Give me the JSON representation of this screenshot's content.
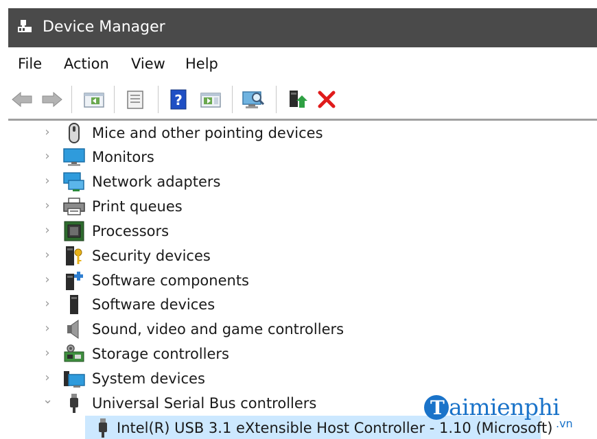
{
  "window": {
    "title": "Device Manager"
  },
  "menu": [
    "File",
    "Action",
    "View",
    "Help"
  ],
  "toolbar": {
    "buttons": [
      "back-icon",
      "forward-icon",
      "properties-pane-icon",
      "properties-sheet-icon",
      "help-icon",
      "action-pane-icon",
      "scan-hardware-icon",
      "update-driver-icon",
      "uninstall-icon"
    ],
    "uninstall_color": "#e01b1b"
  },
  "tree": {
    "nodes": [
      {
        "label": "Mice and other pointing devices",
        "icon": "mouse-icon",
        "expander": "›"
      },
      {
        "label": "Monitors",
        "icon": "monitor-icon",
        "expander": "›"
      },
      {
        "label": "Network adapters",
        "icon": "network-adapter-icon",
        "expander": "›"
      },
      {
        "label": "Print queues",
        "icon": "printer-icon",
        "expander": "›"
      },
      {
        "label": "Processors",
        "icon": "processor-icon",
        "expander": "›"
      },
      {
        "label": "Security devices",
        "icon": "security-device-icon",
        "expander": "›"
      },
      {
        "label": "Software components",
        "icon": "software-component-icon",
        "expander": "›"
      },
      {
        "label": "Software devices",
        "icon": "software-device-icon",
        "expander": "›"
      },
      {
        "label": "Sound, video and game controllers",
        "icon": "speaker-icon",
        "expander": "›"
      },
      {
        "label": "Storage controllers",
        "icon": "storage-controller-icon",
        "expander": "›"
      },
      {
        "label": "System devices",
        "icon": "system-device-icon",
        "expander": "›"
      },
      {
        "label": "Universal Serial Bus controllers",
        "icon": "usb-icon",
        "expander": "⌄"
      }
    ],
    "children": [
      {
        "label": "Intel(R) USB 3.1 eXtensible Host Controller - 1.10 (Microsoft)",
        "icon": "usb-device-icon",
        "selected": true
      }
    ],
    "selection_color": "#cce8ff"
  },
  "watermark": {
    "letter": "T",
    "text": "aimienphi",
    "tld": ".vn",
    "color": "#1a73c9"
  }
}
